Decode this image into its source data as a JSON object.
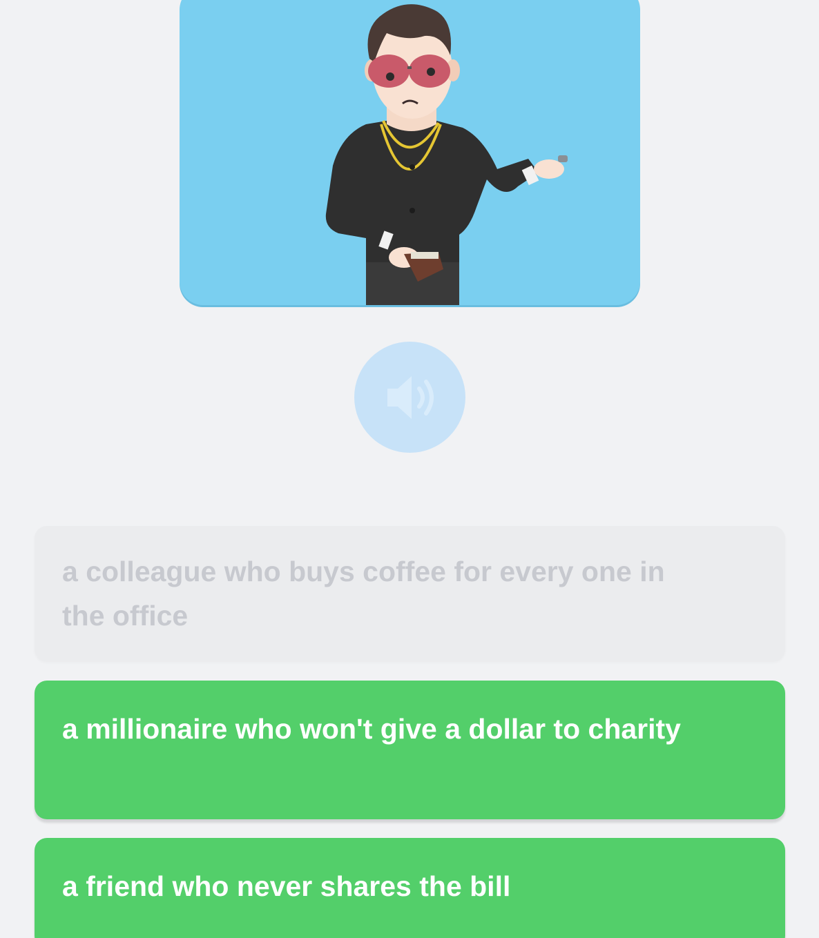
{
  "illustration": {
    "icon": "man-with-sunglasses-and-wallet-illustration",
    "background_color": "#7acff0"
  },
  "audio": {
    "icon": "speaker-icon",
    "color": "#c7e2f8"
  },
  "options": [
    {
      "text": "a colleague who buys coffee for every one in the office",
      "state": "disabled",
      "color": "#ebecee"
    },
    {
      "text": "a millionaire who won't give a dollar to charity",
      "state": "active",
      "color": "#53cf6a"
    },
    {
      "text": "a friend who never shares the bill",
      "state": "active",
      "color": "#53cf6a"
    }
  ]
}
